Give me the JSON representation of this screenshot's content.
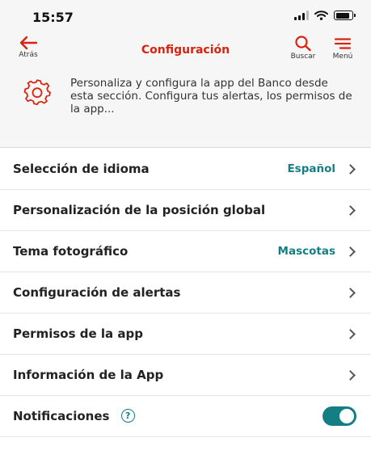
{
  "status_bar": {
    "time": "15:57"
  },
  "header": {
    "back_label": "Atrás",
    "title": "Configuración",
    "search_label": "Buscar",
    "menu_label": "Menú"
  },
  "intro": {
    "text": "Personaliza y configura la app del Banco desde esta sección. Configura tus alertas, los permisos de la app..."
  },
  "settings": {
    "items": [
      {
        "label": "Selección de idioma",
        "value": "Español"
      },
      {
        "label": "Personalización de la posición global"
      },
      {
        "label": "Tema fotográfico",
        "value": "Mascotas"
      },
      {
        "label": "Configuración de alertas"
      },
      {
        "label": "Permisos de la app"
      },
      {
        "label": "Información de la App"
      }
    ],
    "notifications": {
      "label": "Notificaciones",
      "help_symbol": "?",
      "enabled": true
    }
  },
  "colors": {
    "brand_red": "#d9230f",
    "accent_teal": "#137e84"
  }
}
